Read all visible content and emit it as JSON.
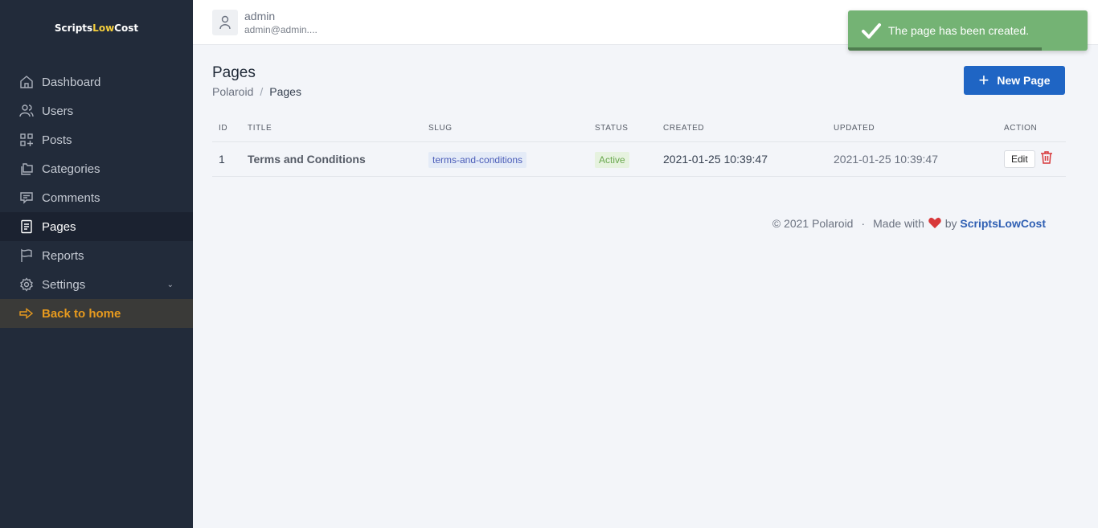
{
  "sidebar": {
    "logo": {
      "part1": "Scripts",
      "part2": "Low",
      "part3": "Cost"
    },
    "items": [
      {
        "label": "Dashboard",
        "icon": "home-icon"
      },
      {
        "label": "Users",
        "icon": "users-icon"
      },
      {
        "label": "Posts",
        "icon": "grid-plus-icon"
      },
      {
        "label": "Categories",
        "icon": "folders-icon"
      },
      {
        "label": "Comments",
        "icon": "comment-icon"
      },
      {
        "label": "Pages",
        "icon": "document-icon",
        "active": true
      },
      {
        "label": "Reports",
        "icon": "flag-icon"
      },
      {
        "label": "Settings",
        "icon": "gear-icon"
      },
      {
        "label": "Back to home",
        "icon": "arrow-right-icon"
      }
    ]
  },
  "header": {
    "user_name": "admin",
    "user_email": "admin@admin...."
  },
  "page": {
    "title": "Pages",
    "breadcrumb": [
      "Polaroid",
      "Pages"
    ],
    "new_button": "New Page"
  },
  "table": {
    "headers": [
      "ID",
      "TITLE",
      "SLUG",
      "STATUS",
      "CREATED",
      "UPDATED",
      "ACTION"
    ],
    "rows": [
      {
        "id": "1",
        "title": "Terms and Conditions",
        "slug": "terms-and-conditions",
        "status": "Active",
        "created": "2021-01-25 10:39:47",
        "updated": "2021-01-25 10:39:47",
        "edit": "Edit"
      }
    ]
  },
  "footer": {
    "copyright": "© 2021 Polaroid",
    "separator": "·",
    "made_with": "Made with",
    "by": "by",
    "brand": "ScriptsLowCost"
  },
  "toast": {
    "message": "The page has been created.",
    "progress": 0.81,
    "color": "#74b374"
  }
}
